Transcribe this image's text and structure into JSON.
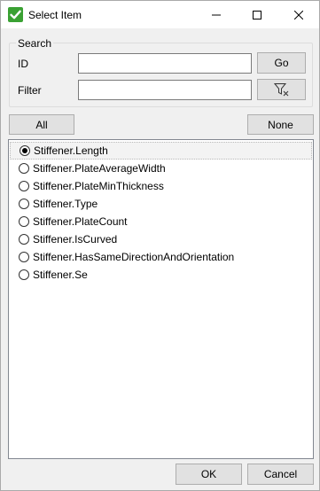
{
  "window": {
    "title": "Select Item"
  },
  "search": {
    "group_label": "Search",
    "id_label": "ID",
    "id_value": "",
    "filter_label": "Filter",
    "filter_value": "",
    "go_label": "Go",
    "filter_icon": "filter-clear-icon"
  },
  "selection": {
    "all_label": "All",
    "none_label": "None"
  },
  "items": [
    {
      "label": "Stiffener.Length",
      "checked": true
    },
    {
      "label": "Stiffener.PlateAverageWidth",
      "checked": false
    },
    {
      "label": "Stiffener.PlateMinThickness",
      "checked": false
    },
    {
      "label": "Stiffener.Type",
      "checked": false
    },
    {
      "label": "Stiffener.PlateCount",
      "checked": false
    },
    {
      "label": "Stiffener.IsCurved",
      "checked": false
    },
    {
      "label": "Stiffener.HasSameDirectionAndOrientation",
      "checked": false
    },
    {
      "label": "Stiffener.Se",
      "checked": false
    }
  ],
  "footer": {
    "ok_label": "OK",
    "cancel_label": "Cancel"
  },
  "colors": {
    "check_green": "#3aa133",
    "window_bg": "#f0f0f0",
    "button_bg": "#e1e1e1"
  }
}
